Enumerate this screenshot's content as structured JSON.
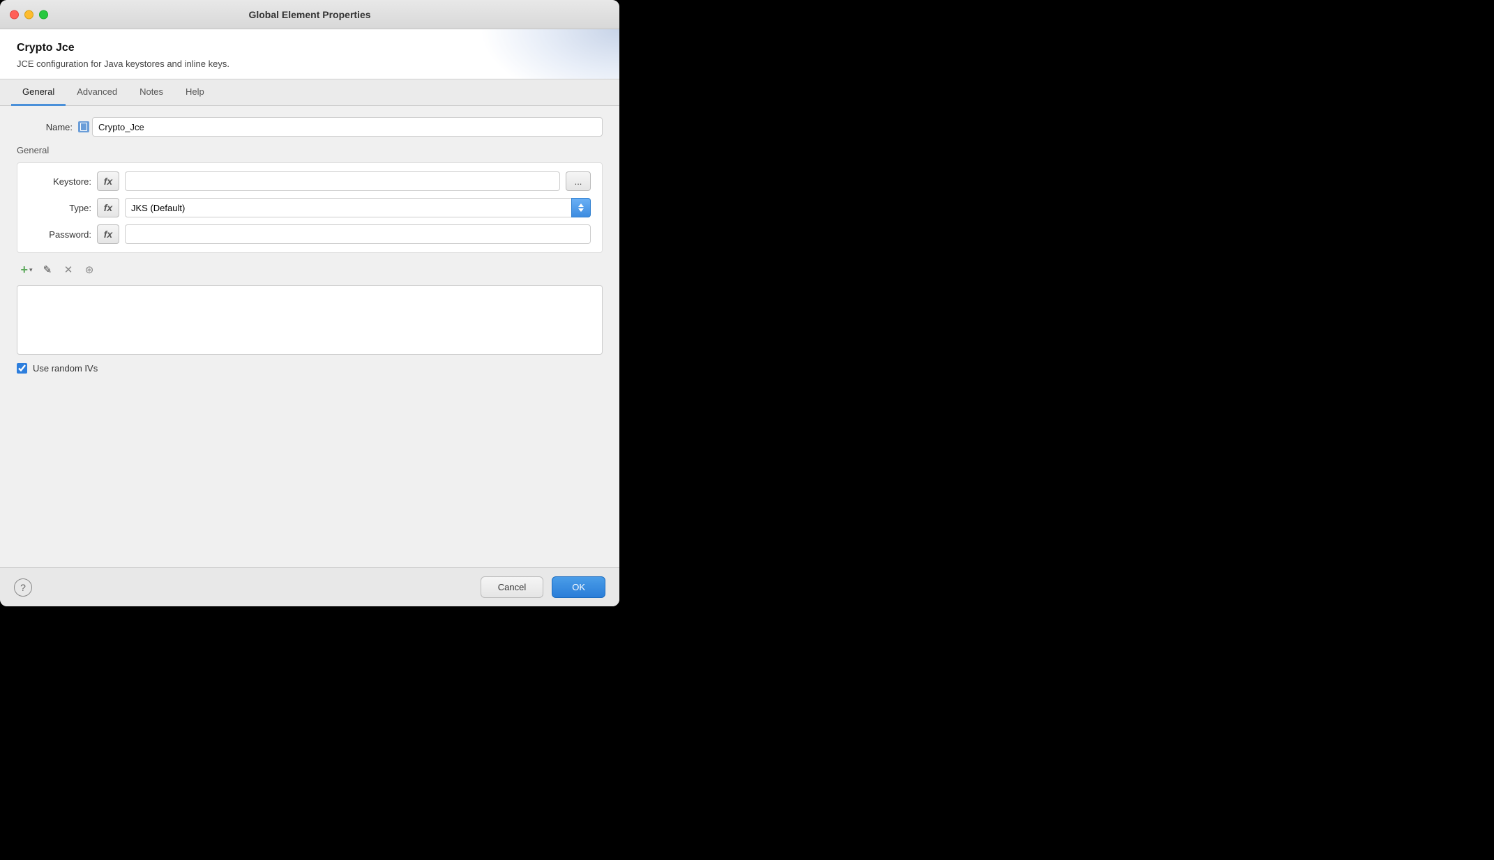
{
  "window": {
    "title": "Global Element Properties"
  },
  "element": {
    "name": "Crypto Jce",
    "description": "JCE configuration for Java keystores and inline keys."
  },
  "tabs": [
    {
      "id": "general",
      "label": "General",
      "active": true
    },
    {
      "id": "advanced",
      "label": "Advanced",
      "active": false
    },
    {
      "id": "notes",
      "label": "Notes",
      "active": false
    },
    {
      "id": "help",
      "label": "Help",
      "active": false
    }
  ],
  "form": {
    "name_label": "Name:",
    "name_value": "Crypto_Jce",
    "section_label": "General",
    "keystore_label": "Keystore:",
    "keystore_value": "",
    "type_label": "Type:",
    "type_value": "JKS (Default)",
    "password_label": "Password:",
    "password_value": "",
    "fx_label": "fx",
    "browse_label": "...",
    "use_random_ivs_label": "Use random IVs",
    "use_random_ivs_checked": true
  },
  "toolbar": {
    "add_label": "+",
    "dropdown_label": "▾",
    "edit_label": "✎",
    "delete_label": "✕",
    "copy_label": "⊕"
  },
  "footer": {
    "help_label": "?",
    "cancel_label": "Cancel",
    "ok_label": "OK"
  }
}
